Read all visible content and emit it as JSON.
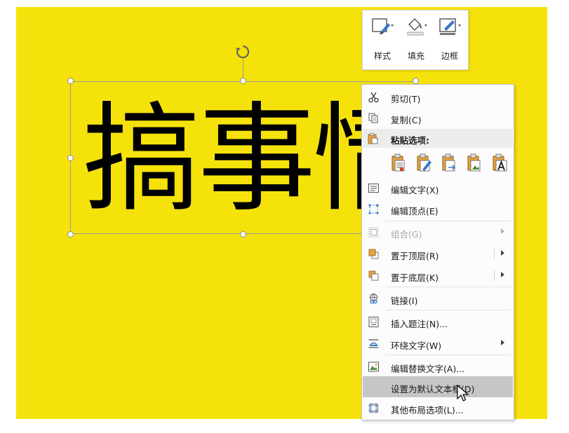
{
  "textbox": {
    "text": "搞事情"
  },
  "mini_toolbar": {
    "buttons": [
      {
        "label": "样式",
        "icon": "style-icon"
      },
      {
        "label": "填充",
        "icon": "fill-bucket-icon"
      },
      {
        "label": "边框",
        "icon": "outline-pen-icon"
      }
    ]
  },
  "context_menu": {
    "cut": "剪切(T)",
    "copy": "复制(C)",
    "paste_header": "粘贴选项:",
    "paste_options": [
      "keep-source-format-icon",
      "use-destination-theme-icon",
      "merge-format-icon",
      "paste-picture-icon",
      "keep-text-only-icon"
    ],
    "edit_text": "编辑文字(X)",
    "edit_points": "编辑顶点(E)",
    "group": "组合(G)",
    "bring_front": "置于顶层(R)",
    "send_back": "置于底层(K)",
    "link": "链接(I)",
    "insert_caption": "插入题注(N)...",
    "wrap_text": "环绕文字(W)",
    "edit_alt_text": "编辑替换文字(A)...",
    "set_default_textbox": "设置为默认文本框(D)",
    "more_layout": "其他布局选项(L)..."
  },
  "colors": {
    "slide_background": "#f5e20b",
    "hover_background": "#c6c6c6",
    "accent_orange": "#e8a33d",
    "accent_blue": "#3b78c6"
  }
}
